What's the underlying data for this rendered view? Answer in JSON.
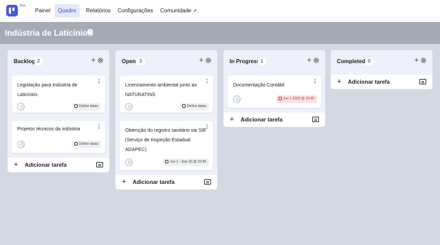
{
  "app": {
    "badge": "Pró"
  },
  "nav": {
    "items": [
      {
        "label": "Painel"
      },
      {
        "label": "Quadro"
      },
      {
        "label": "Relatórios"
      },
      {
        "label": "Configurações"
      },
      {
        "label": "Comunidade"
      }
    ],
    "external_glyph": "↗",
    "active_color": "#3a49d6"
  },
  "board": {
    "title": "Indústria de LaticínioS",
    "info_glyph": "i"
  },
  "columns": [
    {
      "title": "Backlog",
      "count": "2",
      "cards": [
        {
          "title": "Legislação para indústria de Laticínios",
          "date": "Definir datas"
        },
        {
          "title": "Projetos técnicos da indústria",
          "date": "Definir datas"
        }
      ],
      "add_label": "Adicionar tarefa"
    },
    {
      "title": "Open",
      "count": "2",
      "cards": [
        {
          "title": "Licenciamento ambiental junto ao NATURATINS",
          "date": "Definir datas"
        },
        {
          "title": "Obtenção do registro sanitário via SIE (Serviço de Inspeção Estadual ADAPEC)",
          "date": "Jun 1 - Sep 30 @ 23:45"
        }
      ],
      "add_label": "Adicionar tarefa"
    },
    {
      "title": "In Progress",
      "count": "1",
      "cards": [
        {
          "title": "Documentação Contábil",
          "date": "Jun 1 2026 @ 23:45"
        }
      ],
      "add_label": "Adicionar tarefa"
    },
    {
      "title": "Completed",
      "count": "0",
      "cards": [],
      "add_label": "Adicionar tarefa"
    }
  ],
  "glyphs": {
    "plus": "+",
    "menu": "⋮"
  },
  "colors": {
    "logo": "#4a5ae0",
    "title_bar": "#a4abb5",
    "overdue": "#c03434"
  }
}
